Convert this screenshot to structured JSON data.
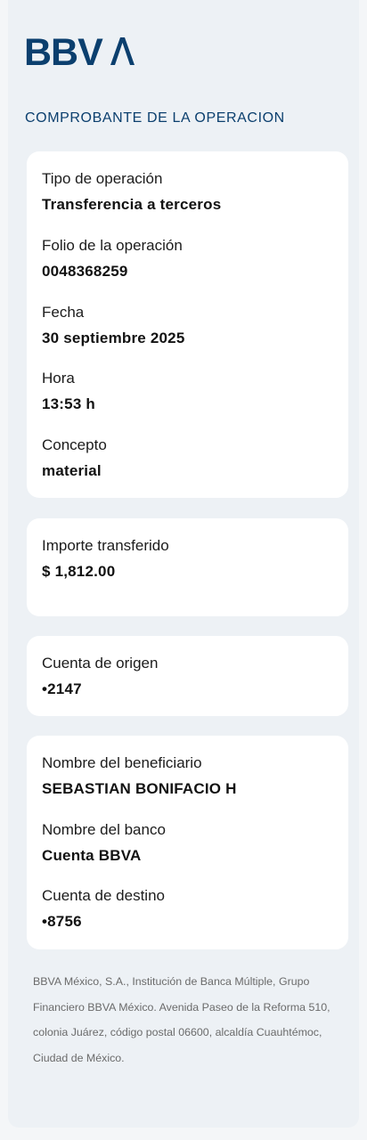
{
  "brand": {
    "name": "BBVA",
    "color": "#0b3f6e",
    "icon": "bbva-logo"
  },
  "header": {
    "title": "COMPROBANTE DE LA OPERACION"
  },
  "operation": {
    "type_label": "Tipo de operación",
    "type_value": "Transferencia a terceros",
    "folio_label": "Folio de la operación",
    "folio_value": "0048368259",
    "date_label": "Fecha",
    "date_value": "30 septiembre 2025",
    "time_label": "Hora",
    "time_value": "13:53 h",
    "concept_label": "Concepto",
    "concept_value": "material"
  },
  "amount": {
    "label": "Importe transferido",
    "value": "$ 1,812.00"
  },
  "origin": {
    "label": "Cuenta de origen",
    "value": "•2147"
  },
  "beneficiary": {
    "name_label": "Nombre del beneficiario",
    "name_value": "SEBASTIAN BONIFACIO H",
    "bank_label": "Nombre del banco",
    "bank_value": "Cuenta BBVA",
    "account_label": "Cuenta de destino",
    "account_value": "•8756"
  },
  "footer": {
    "legal": "BBVA México, S.A., Institución de Banca Múltiple, Grupo Financiero BBVA México. Avenida Paseo de la Reforma 510, colonia Juárez, código postal 06600, alcaldía Cuauhtémoc, Ciudad de México."
  }
}
